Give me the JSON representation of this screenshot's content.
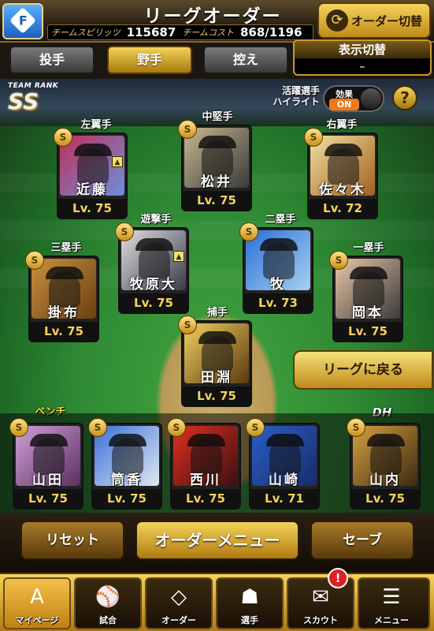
{
  "header": {
    "title": "リーグオーダー",
    "badge_letter": "F",
    "spirits_label": "チームスピリッツ",
    "spirits_value": "115687",
    "cost_label": "チームコスト",
    "cost_value": "868/1196",
    "order_switch_label": "オーダー切替"
  },
  "tabs": [
    {
      "label": "投手",
      "active": false
    },
    {
      "label": "野手",
      "active": true
    },
    {
      "label": "控え",
      "active": false
    }
  ],
  "display_switch": {
    "label": "表示切替",
    "value": "–"
  },
  "team_rank": {
    "label": "TEAM RANK",
    "value": "SS"
  },
  "highlight": {
    "label_line1": "活躍選手",
    "label_line2": "ハイライト",
    "effect_label": "効果",
    "effect_state": "ON"
  },
  "help_label": "?",
  "players": [
    {
      "position": "左翼手",
      "name": "近藤",
      "level": "Lv. 75",
      "rank": "S",
      "colors": [
        "#c0305a",
        "#6a90d8"
      ]
    },
    {
      "position": "中堅手",
      "name": "松井",
      "level": "Lv. 75",
      "rank": "S",
      "colors": [
        "#c8b890",
        "#3a3a3a"
      ]
    },
    {
      "position": "右翼手",
      "name": "佐々木",
      "level": "Lv. 72",
      "rank": "S",
      "colors": [
        "#f0e0a0",
        "#a06020"
      ]
    },
    {
      "position": "遊撃手",
      "name": "牧原大",
      "level": "Lv. 75",
      "rank": "S",
      "colors": [
        "#e0e0e0",
        "#3a3a4a"
      ]
    },
    {
      "position": "二塁手",
      "name": "牧",
      "level": "Lv. 73",
      "rank": "S",
      "colors": [
        "#2a70d8",
        "#a8d0f0"
      ]
    },
    {
      "position": "三塁手",
      "name": "掛布",
      "level": "Lv. 75",
      "rank": "S",
      "colors": [
        "#c89040",
        "#6a4010"
      ]
    },
    {
      "position": "一塁手",
      "name": "岡本",
      "level": "Lv. 75",
      "rank": "S",
      "colors": [
        "#e8c8a8",
        "#3a3a3a"
      ]
    },
    {
      "position": "捕手",
      "name": "田淵",
      "level": "Lv. 75",
      "rank": "S",
      "colors": [
        "#f0d060",
        "#5a3a10"
      ]
    }
  ],
  "bench": {
    "label": "ベンチ",
    "dh_label": "DH",
    "players": [
      {
        "name": "山田",
        "level": "Lv. 75",
        "rank": "S",
        "colors": [
          "#d0a0d8",
          "#5a3060"
        ]
      },
      {
        "name": "筒香",
        "level": "Lv. 75",
        "rank": "S",
        "colors": [
          "#3a70d8",
          "#e0e8f0"
        ]
      },
      {
        "name": "西川",
        "level": "Lv. 75",
        "rank": "S",
        "colors": [
          "#e03020",
          "#3a1010"
        ]
      },
      {
        "name": "山崎",
        "level": "Lv. 71",
        "rank": "S",
        "colors": [
          "#2a60c8",
          "#1a2a6a"
        ]
      },
      {
        "name": "山内",
        "level": "Lv. 75",
        "rank": "S",
        "colors": [
          "#d8a040",
          "#3a2a10"
        ]
      }
    ]
  },
  "back_league_label": "リーグに戻る",
  "buttons": {
    "reset": "リセット",
    "order_menu": "オーダーメニュー",
    "save": "セーブ"
  },
  "nav": [
    {
      "label": "マイページ",
      "icon": "A",
      "active": true
    },
    {
      "label": "試合",
      "icon": "⚾",
      "active": false
    },
    {
      "label": "オーダー",
      "icon": "◇",
      "active": false
    },
    {
      "label": "選手",
      "icon": "☗",
      "active": false
    },
    {
      "label": "スカウト",
      "icon": "✉",
      "active": false
    },
    {
      "label": "メニュー",
      "icon": "☰",
      "active": false
    }
  ],
  "notify_label": "!"
}
